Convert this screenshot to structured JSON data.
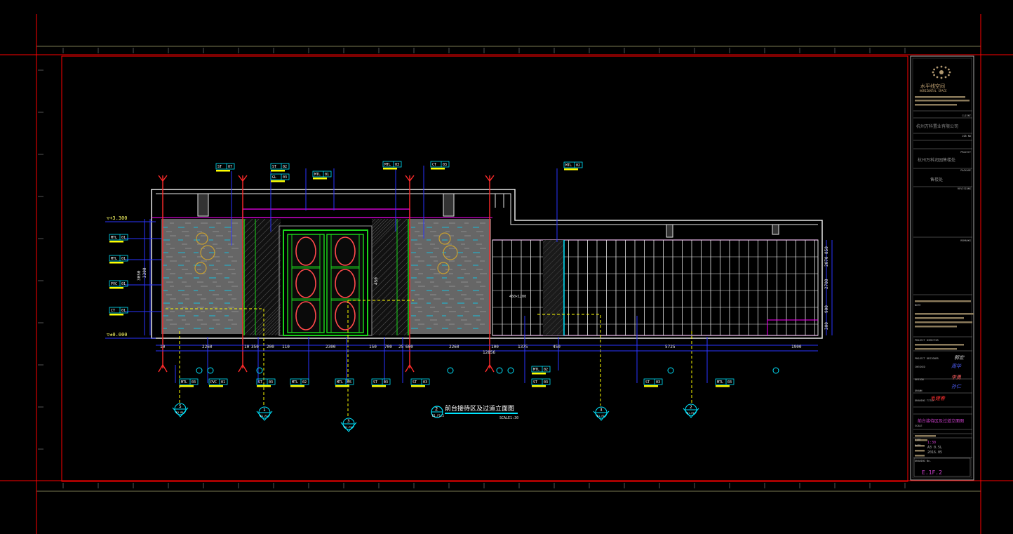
{
  "drawing": {
    "title": "前台接待区及过道立面图",
    "scale": "SCALE1:30",
    "drawing_no": "2",
    "sheet_ref": "E1.F1.2",
    "levels": {
      "top": "▽+3.300",
      "floor": "▽±0.000"
    },
    "dimensions": [
      "10",
      "2260",
      "10",
      "350",
      "200",
      "110",
      "2300",
      "150",
      "700",
      "25",
      "600",
      "2260",
      "100",
      "1375",
      "450",
      "5725",
      "1900"
    ],
    "overall_dim": "12856",
    "side_dims": [
      "3050",
      "3300",
      "2700",
      "900",
      "2070",
      "300",
      "850",
      "450"
    ],
    "opening_label": "450×1200",
    "tags_top": [
      "ST 07",
      "ST 02",
      "GL 03",
      "MTL 01",
      "MTL 03",
      "CT 03",
      "MTL 02"
    ],
    "tags_left": [
      "MTL 01",
      "MTL 01",
      "PVC 01",
      "CT 01"
    ],
    "tags_bottom": [
      "MTL 03",
      "PVC 01",
      "ST 03",
      "MTL 02",
      "MTL 05",
      "ST 03",
      "ST 03",
      "ST 03",
      "MTL 02",
      "ST 03",
      "MTL 03"
    ],
    "section_markers": [
      {
        "num": "5",
        "ref": "E1.B1"
      },
      {
        "num": "1",
        "ref": "E1.F2"
      },
      {
        "num": "3",
        "ref": "E1.F2"
      },
      {
        "num": "3",
        "ref": "E1.F2"
      },
      {
        "num": "2",
        "ref": "E1.F2"
      }
    ]
  },
  "title_block": {
    "logo_text": "水平线空间",
    "logo_sub": "HORIZONTAL SPACE",
    "client": "杭州万科置业有限公司",
    "project": "杭州万科润园售楼处",
    "package": "售楼处",
    "sheet_title": "前台接待区及过道立面图",
    "scale_value": "1:30",
    "size_value": "A3  0.5L",
    "date_value": "2016.05",
    "sheet_no": "E.1F.2",
    "field_labels": [
      "CLIENT",
      "JOB NO",
      "PROJECT",
      "PACKAGE",
      "REVISIONS",
      "REMARKS",
      "NOTE",
      "PROJECT DIRECTOR",
      "PROJECT DESIGNER",
      "CHECKED",
      "DESIGN",
      "DRAWN",
      "DRAWING TITLE",
      "SCALE",
      "SIZE",
      "DATE",
      "DRAWING No."
    ],
    "signatures": [
      "郭宏",
      "周华",
      "李勇",
      "孙仁",
      "毛建春"
    ]
  },
  "colors": {
    "background": "#000000",
    "frame_red": "#ff0000",
    "frame_gray": "#7a7a52",
    "wall_white": "#e6e6e6",
    "cyan": "#00e5ff",
    "yellow": "#ffff00",
    "magenta": "#ff00ff",
    "blue": "#1e28ff",
    "green": "#1bd21b",
    "panel_gray": "#6b6b6b"
  }
}
